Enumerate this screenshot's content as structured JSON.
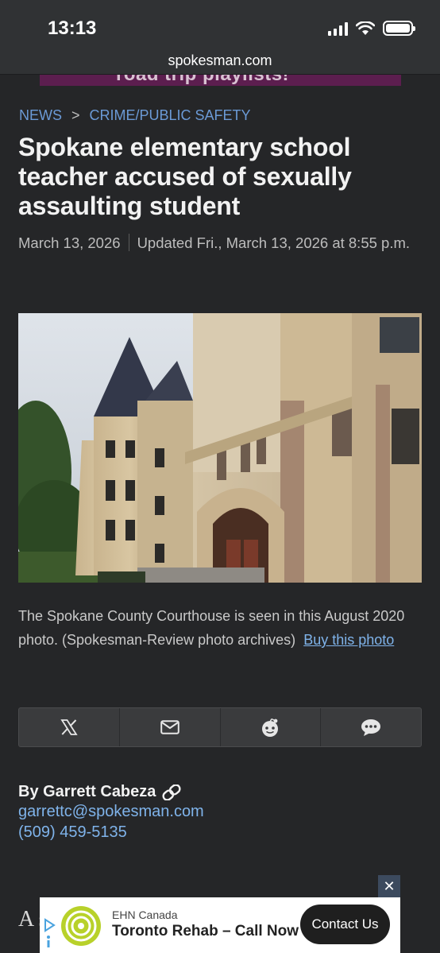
{
  "status_bar": {
    "time": "13:13"
  },
  "browser": {
    "url": "spokesman.com"
  },
  "top_ad": {
    "text": "road trip playlists!"
  },
  "breadcrumb": {
    "section": "NEWS",
    "separator": ">",
    "subsection": "CRIME/PUBLIC SAFETY"
  },
  "article": {
    "headline": "Spokane elementary school teacher accused of sexually assaulting student",
    "date": "March 13, 2026",
    "updated": "Updated Fri., March 13, 2026 at 8:55 p.m.",
    "caption": "The Spokane County Courthouse is seen in this August 2020 photo. (Spokesman-Review photo archives)",
    "buy_photo": "Buy this photo",
    "lead_text": "A s"
  },
  "share": {
    "icons": [
      "x-icon",
      "email-icon",
      "reddit-icon",
      "comment-icon"
    ]
  },
  "byline": {
    "author": "By Garrett Cabeza",
    "email": "garrettc@spokesman.com",
    "phone": "(509) 459-5135"
  },
  "bottom_ad": {
    "close": "✕",
    "sponsor": "EHN Canada",
    "title": "Toronto Rehab – Call Now",
    "cta": "Contact Us"
  },
  "colors": {
    "background": "#252628",
    "link": "#7fb3ea",
    "breadcrumb": "#6b9ad6",
    "ad_logo": "#b8d12a"
  }
}
